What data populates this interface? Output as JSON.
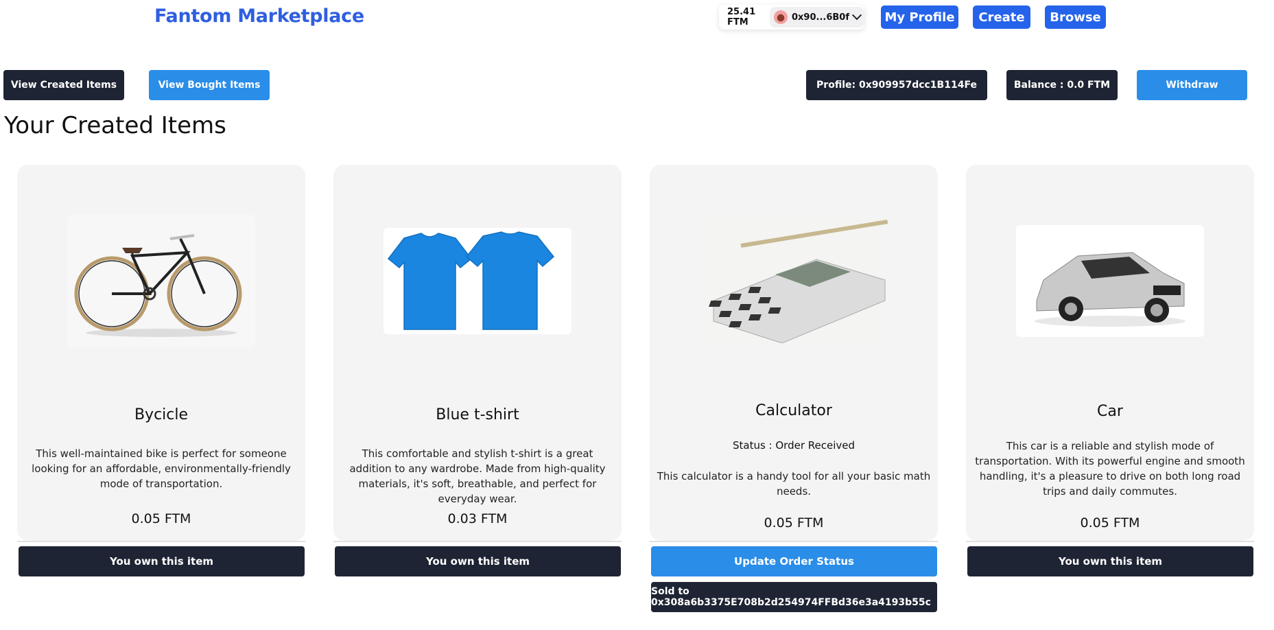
{
  "header": {
    "brand": "Fantom Marketplace",
    "wallet_balance": "25.41 FTM",
    "wallet_address": "0x90...6B0f",
    "nav": {
      "my_profile": "My Profile",
      "create": "Create",
      "browse": "Browse"
    }
  },
  "toolbar": {
    "view_created": "View Created Items",
    "view_bought": "View Bought Items",
    "profile": "Profile: 0x909957dcc1B114Fe",
    "balance": "Balance : 0.0 FTM",
    "withdraw": "Withdraw"
  },
  "section_title": "Your Created Items",
  "items": [
    {
      "title": "Bycicle",
      "description": "This well-maintained bike is perfect for someone looking for an affordable, environmentally-friendly mode of transportation.",
      "price": "0.05 FTM",
      "action": "You own this item"
    },
    {
      "title": "Blue t-shirt",
      "description": "This comfortable and stylish t-shirt is a great addition to any wardrobe. Made from high-quality materials, it's soft, breathable, and perfect for everyday wear.",
      "price": "0.03 FTM",
      "action": "You own this item"
    },
    {
      "title": "Calculator",
      "status": "Status : Order Received",
      "description": "This calculator is a handy tool for all your basic math needs.",
      "price": "0.05 FTM",
      "action": "Update Order Status",
      "sold_to": "Sold to 0x308a6b3375E708b2d254974FFBd36e3a4193b55c"
    },
    {
      "title": "Car",
      "description": "This car is a reliable and stylish mode of transportation. With its powerful engine and smooth handling, it's a pleasure to drive on both long road trips and daily commutes.",
      "price": "0.05 FTM",
      "action": "You own this item"
    }
  ],
  "colors": {
    "brand": "#2f5fe0",
    "nav_button": "#2563eb",
    "dark_button": "#1e2433",
    "blue_button": "#2a8de8",
    "card_bg": "#f4f4f4"
  }
}
